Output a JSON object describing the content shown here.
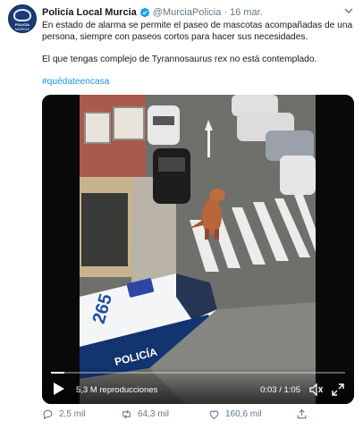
{
  "account": {
    "display_name": "Policía Local Murcia",
    "handle": "@MurciaPolicia",
    "separator": "·",
    "date": "16 mar.",
    "avatar_line1": "POLICÍA",
    "avatar_line2": "MURCIA"
  },
  "tweet": {
    "line1": "En estado de alarma se permite el paseo de mascotas acompañadas de una persona, siempre con paseos cortos para hacer sus necesidades.",
    "line2": "El que tengas complejo de Tyrannosaurus rex no está contemplado.",
    "hashtag": "#quédateencasa"
  },
  "video": {
    "views": "5,3 M reproducciones",
    "time": "0:03 / 1:05",
    "progress": 0.046,
    "car_number": "265",
    "car_text": "POLICÍA"
  },
  "actions": {
    "replies": "2,5 mil",
    "retweets": "64,3 mil",
    "likes": "160,6 mil"
  },
  "colors": {
    "link": "#1b95e0",
    "secondary": "#657786",
    "verified": "#1da1f2"
  },
  "icons": [
    "verified-icon",
    "chevron-down-icon",
    "play-icon",
    "volume-icon",
    "fullscreen-icon",
    "reply-icon",
    "retweet-icon",
    "like-icon",
    "share-icon"
  ]
}
